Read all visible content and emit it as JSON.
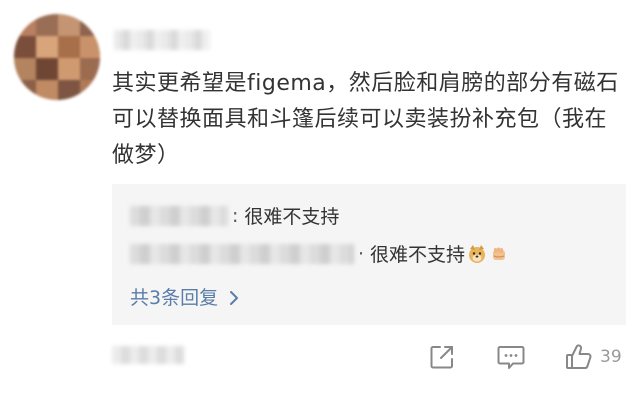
{
  "comment": {
    "text": "其实更希望是figema，然后脸和肩膀的部分有磁石可以替换面具和斗篷后续可以卖装扮补充包（我在做梦）"
  },
  "replies": [
    {
      "separator": ":",
      "text": "很难不支持"
    },
    {
      "separator": "·",
      "text": "很难不支持"
    }
  ],
  "more_replies_label": "共3条回复",
  "actions": {
    "like_count": "39"
  },
  "icons": {
    "share": "share-icon",
    "reply": "comment-icon",
    "like": "thumbs-up-icon",
    "more_chevron": "chevron-right-icon",
    "doge": "doge-emoji-icon",
    "fist": "fist-emoji-icon"
  },
  "colors": {
    "link": "#5b7da8",
    "reply_bg": "#f5f5f5",
    "icon_gray": "#888888"
  }
}
